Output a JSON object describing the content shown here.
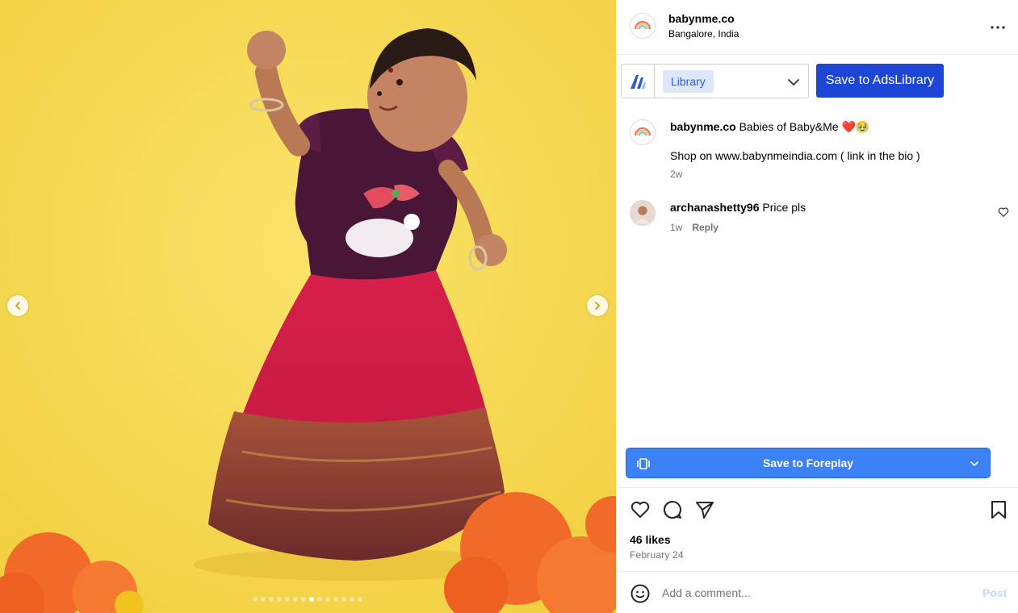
{
  "post": {
    "username": "babynme.co",
    "location": "Bangalore, India",
    "carousel_total": 14,
    "carousel_active": 8
  },
  "adslibrary": {
    "selected_library": "Library",
    "save_button": "Save to AdsLibrary"
  },
  "caption": {
    "username": "babynme.co",
    "text": "Babies of Baby&Me ❤️🥹",
    "line2": "Shop on www.babynmeindia.com ( link in the bio )",
    "time": "2w"
  },
  "comments": [
    {
      "username": "archanashetty96",
      "text": "Price pls",
      "time": "1w",
      "reply_label": "Reply"
    }
  ],
  "foreplay": {
    "label": "Save to Foreplay"
  },
  "engagement": {
    "likes": "46 likes",
    "date": "February 24"
  },
  "add_comment": {
    "placeholder": "Add a comment...",
    "post_label": "Post"
  },
  "colors": {
    "accent": "#1d46d6",
    "foreplay": "#3b82f6",
    "background_photo": "#f6d84f"
  }
}
